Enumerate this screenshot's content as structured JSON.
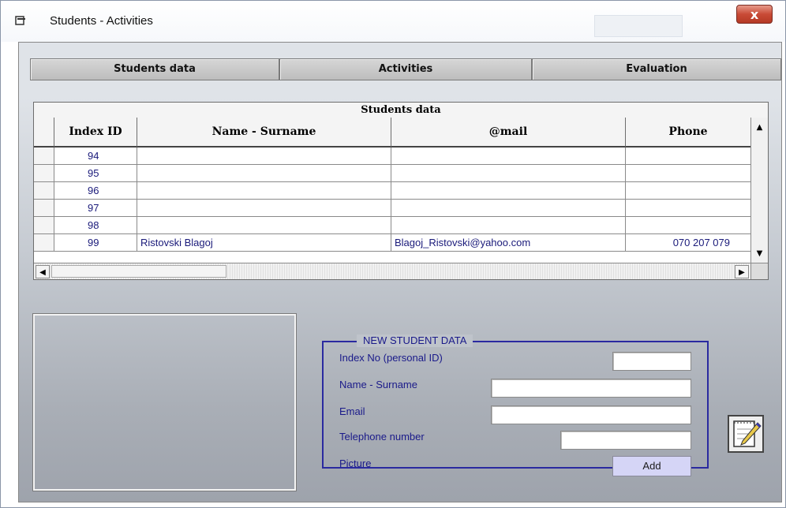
{
  "window": {
    "title": "Students  -  Activities",
    "close_label": "x",
    "app_icon": "window-icon"
  },
  "tabs": [
    {
      "label": "Students data"
    },
    {
      "label": "Activities"
    },
    {
      "label": "Evaluation"
    }
  ],
  "grid": {
    "caption": "Students data",
    "columns": [
      "Index ID",
      "Name - Surname",
      "@mail",
      "Phone"
    ],
    "rows": [
      {
        "id": "94",
        "name": "",
        "mail": "",
        "phone": ""
      },
      {
        "id": "95",
        "name": "",
        "mail": "",
        "phone": ""
      },
      {
        "id": "96",
        "name": "",
        "mail": "",
        "phone": ""
      },
      {
        "id": "97",
        "name": "",
        "mail": "",
        "phone": ""
      },
      {
        "id": "98",
        "name": "",
        "mail": "",
        "phone": ""
      },
      {
        "id": "99",
        "name": "Ristovski Blagoj",
        "mail": "Blagoj_Ristovski@yahoo.com",
        "phone": "070 207 079"
      }
    ],
    "scroll_up_icon": "arrow-up-icon",
    "scroll_down_icon": "arrow-down-icon",
    "scroll_left_icon": "arrow-left-icon",
    "scroll_right_icon": "arrow-right-icon"
  },
  "new_student": {
    "legend": "NEW STUDENT DATA",
    "index_label": "Index No (personal ID)",
    "name_label": "Name - Surname",
    "email_label": "Email",
    "phone_label": "Telephone number",
    "picture_label": "Picture",
    "index_value": "",
    "name_value": "",
    "email_value": "",
    "phone_value": "",
    "add_label": "Add"
  },
  "notepad_button_icon": "notepad-pen-icon",
  "colors": {
    "label_blue": "#1a1a8a",
    "close_red": "#c94a36",
    "add_button": "#d5d5f6"
  }
}
